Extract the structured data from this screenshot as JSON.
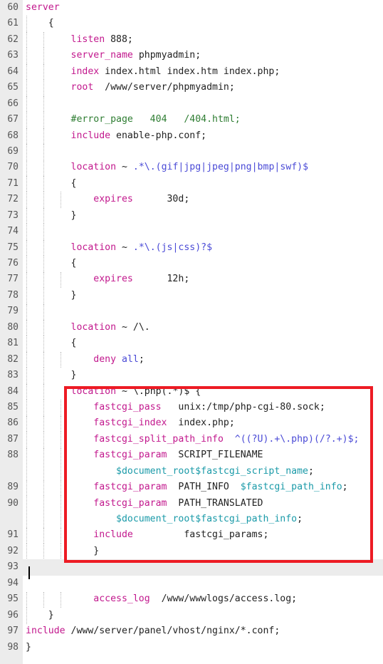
{
  "editor": {
    "language": "nginx",
    "colors": {
      "gutter_bg": "#ececec",
      "background": "#ffffff",
      "keyword": "#c2188d",
      "comment": "#2e7d32",
      "regex": "#4a4ad6",
      "variable": "#1a9aa8",
      "plain": "#222222",
      "line_number": "#555555",
      "current_line_bg": "#ececec",
      "annotation_border": "#ed1b24"
    },
    "current_line": "93",
    "first_line": "60",
    "last_line": "98"
  },
  "annotation": {
    "name": "red-highlight-box",
    "covers_lines": "84-92",
    "border_color": "#ed1b24"
  },
  "lines": [
    {
      "n": "60",
      "indent": 0,
      "wrapped": false,
      "tokens": [
        {
          "t": "server",
          "c": "kw"
        }
      ]
    },
    {
      "n": "61",
      "indent": 1,
      "wrapped": false,
      "tokens": [
        {
          "t": "{",
          "c": "pl"
        }
      ]
    },
    {
      "n": "62",
      "indent": 2,
      "wrapped": false,
      "tokens": [
        {
          "t": "listen",
          "c": "kw"
        },
        {
          "t": " 888;",
          "c": "pl"
        }
      ]
    },
    {
      "n": "63",
      "indent": 2,
      "wrapped": false,
      "tokens": [
        {
          "t": "server_name",
          "c": "kw"
        },
        {
          "t": " phpmyadmin;",
          "c": "pl"
        }
      ]
    },
    {
      "n": "64",
      "indent": 2,
      "wrapped": false,
      "tokens": [
        {
          "t": "index",
          "c": "kw"
        },
        {
          "t": " index.html index.htm index.php;",
          "c": "pl"
        }
      ]
    },
    {
      "n": "65",
      "indent": 2,
      "wrapped": false,
      "tokens": [
        {
          "t": "root",
          "c": "kw"
        },
        {
          "t": "  /www/server/phpmyadmin;",
          "c": "pl"
        }
      ]
    },
    {
      "n": "66",
      "indent": 2,
      "wrapped": false,
      "tokens": []
    },
    {
      "n": "67",
      "indent": 2,
      "wrapped": false,
      "tokens": [
        {
          "t": "#error_page   404   /404.html;",
          "c": "cm"
        }
      ]
    },
    {
      "n": "68",
      "indent": 2,
      "wrapped": false,
      "tokens": [
        {
          "t": "include",
          "c": "kw"
        },
        {
          "t": " enable-php.conf;",
          "c": "pl"
        }
      ]
    },
    {
      "n": "69",
      "indent": 2,
      "wrapped": false,
      "tokens": []
    },
    {
      "n": "70",
      "indent": 2,
      "wrapped": false,
      "tokens": [
        {
          "t": "location",
          "c": "kw"
        },
        {
          "t": " ~ ",
          "c": "pl"
        },
        {
          "t": ".*\\.(gif|jpg|jpeg|png|bmp|swf)$",
          "c": "rx"
        }
      ]
    },
    {
      "n": "71",
      "indent": 2,
      "wrapped": false,
      "tokens": [
        {
          "t": "{",
          "c": "pl"
        }
      ]
    },
    {
      "n": "72",
      "indent": 3,
      "wrapped": false,
      "tokens": [
        {
          "t": "expires",
          "c": "kw"
        },
        {
          "t": "      30d;",
          "c": "pl"
        }
      ]
    },
    {
      "n": "73",
      "indent": 2,
      "wrapped": false,
      "tokens": [
        {
          "t": "}",
          "c": "pl"
        }
      ]
    },
    {
      "n": "74",
      "indent": 2,
      "wrapped": false,
      "tokens": []
    },
    {
      "n": "75",
      "indent": 2,
      "wrapped": false,
      "tokens": [
        {
          "t": "location",
          "c": "kw"
        },
        {
          "t": " ~ ",
          "c": "pl"
        },
        {
          "t": ".*\\.(js|css)?$",
          "c": "rx"
        }
      ]
    },
    {
      "n": "76",
      "indent": 2,
      "wrapped": false,
      "tokens": [
        {
          "t": "{",
          "c": "pl"
        }
      ]
    },
    {
      "n": "77",
      "indent": 3,
      "wrapped": false,
      "tokens": [
        {
          "t": "expires",
          "c": "kw"
        },
        {
          "t": "      12h;",
          "c": "pl"
        }
      ]
    },
    {
      "n": "78",
      "indent": 2,
      "wrapped": false,
      "tokens": [
        {
          "t": "}",
          "c": "pl"
        }
      ]
    },
    {
      "n": "79",
      "indent": 2,
      "wrapped": false,
      "tokens": []
    },
    {
      "n": "80",
      "indent": 2,
      "wrapped": false,
      "tokens": [
        {
          "t": "location",
          "c": "kw"
        },
        {
          "t": " ~ /\\.",
          "c": "pl"
        }
      ]
    },
    {
      "n": "81",
      "indent": 2,
      "wrapped": false,
      "tokens": [
        {
          "t": "{",
          "c": "pl"
        }
      ]
    },
    {
      "n": "82",
      "indent": 3,
      "wrapped": false,
      "tokens": [
        {
          "t": "deny",
          "c": "kw"
        },
        {
          "t": " ",
          "c": "pl"
        },
        {
          "t": "all",
          "c": "rx"
        },
        {
          "t": ";",
          "c": "pl"
        }
      ]
    },
    {
      "n": "83",
      "indent": 2,
      "wrapped": false,
      "tokens": [
        {
          "t": "}",
          "c": "pl"
        }
      ]
    },
    {
      "n": "84",
      "indent": 2,
      "wrapped": false,
      "tokens": [
        {
          "t": "location",
          "c": "kw"
        },
        {
          "t": " ~ \\.php(.*)$ {",
          "c": "pl"
        }
      ]
    },
    {
      "n": "85",
      "indent": 3,
      "wrapped": false,
      "tokens": [
        {
          "t": "fastcgi_pass",
          "c": "kw"
        },
        {
          "t": "   unix:/tmp/php-cgi-80.sock;",
          "c": "pl"
        }
      ]
    },
    {
      "n": "86",
      "indent": 3,
      "wrapped": false,
      "tokens": [
        {
          "t": "fastcgi_index",
          "c": "kw"
        },
        {
          "t": "  index.php;",
          "c": "pl"
        }
      ]
    },
    {
      "n": "87",
      "indent": 3,
      "wrapped": false,
      "tokens": [
        {
          "t": "fastcgi_split_path_info",
          "c": "kw"
        },
        {
          "t": "  ^((?U).+\\.php)(/?.+)$;",
          "c": "rx"
        }
      ]
    },
    {
      "n": "88",
      "indent": 3,
      "wrapped": true,
      "tokens": [
        {
          "t": "fastcgi_param",
          "c": "kw"
        },
        {
          "t": "  SCRIPT_FILENAME",
          "c": "pl"
        }
      ],
      "tokens2": [
        {
          "t": "$document_root$fastcgi_script_name",
          "c": "var"
        },
        {
          "t": ";",
          "c": "pl"
        }
      ],
      "wrap_indent": 4
    },
    {
      "n": "89",
      "indent": 3,
      "wrapped": false,
      "tokens": [
        {
          "t": "fastcgi_param",
          "c": "kw"
        },
        {
          "t": "  PATH_INFO  ",
          "c": "pl"
        },
        {
          "t": "$fastcgi_path_info",
          "c": "var"
        },
        {
          "t": ";",
          "c": "pl"
        }
      ]
    },
    {
      "n": "90",
      "indent": 3,
      "wrapped": true,
      "tokens": [
        {
          "t": "fastcgi_param",
          "c": "kw"
        },
        {
          "t": "  PATH_TRANSLATED",
          "c": "pl"
        }
      ],
      "tokens2": [
        {
          "t": "$document_root$fastcgi_path_info",
          "c": "var"
        },
        {
          "t": ";",
          "c": "pl"
        }
      ],
      "wrap_indent": 4
    },
    {
      "n": "91",
      "indent": 3,
      "wrapped": false,
      "tokens": [
        {
          "t": "include",
          "c": "kw"
        },
        {
          "t": "         fastcgi_params;",
          "c": "pl"
        }
      ]
    },
    {
      "n": "92",
      "indent": 3,
      "wrapped": false,
      "tokens": [
        {
          "t": "}",
          "c": "pl"
        }
      ]
    },
    {
      "n": "93",
      "indent": 0,
      "wrapped": false,
      "current": true,
      "tokens": []
    },
    {
      "n": "94",
      "indent": 0,
      "wrapped": false,
      "tokens": []
    },
    {
      "n": "95",
      "indent": 3,
      "wrapped": false,
      "tokens": [
        {
          "t": "access_log",
          "c": "kw"
        },
        {
          "t": "  /www/wwwlogs/access.log;",
          "c": "pl"
        }
      ]
    },
    {
      "n": "96",
      "indent": 1,
      "wrapped": false,
      "tokens": [
        {
          "t": "}",
          "c": "pl"
        }
      ]
    },
    {
      "n": "97",
      "indent": 0,
      "wrapped": false,
      "tokens": [
        {
          "t": "include",
          "c": "kw"
        },
        {
          "t": " /www/server/panel/vhost/nginx/*.conf;",
          "c": "pl"
        }
      ]
    },
    {
      "n": "98",
      "indent": 0,
      "wrapped": false,
      "tokens": [
        {
          "t": "}",
          "c": "pl"
        }
      ]
    }
  ]
}
